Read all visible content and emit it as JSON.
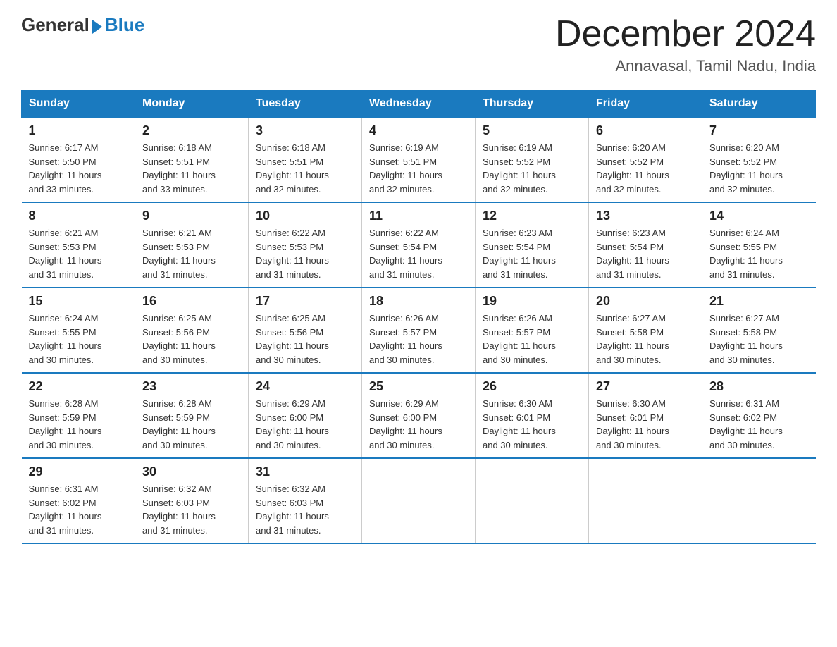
{
  "header": {
    "logo_general": "General",
    "logo_blue": "Blue",
    "title": "December 2024",
    "subtitle": "Annavasal, Tamil Nadu, India"
  },
  "days_of_week": [
    "Sunday",
    "Monday",
    "Tuesday",
    "Wednesday",
    "Thursday",
    "Friday",
    "Saturday"
  ],
  "weeks": [
    [
      {
        "day": "1",
        "sunrise": "6:17 AM",
        "sunset": "5:50 PM",
        "daylight": "11 hours and 33 minutes."
      },
      {
        "day": "2",
        "sunrise": "6:18 AM",
        "sunset": "5:51 PM",
        "daylight": "11 hours and 33 minutes."
      },
      {
        "day": "3",
        "sunrise": "6:18 AM",
        "sunset": "5:51 PM",
        "daylight": "11 hours and 32 minutes."
      },
      {
        "day": "4",
        "sunrise": "6:19 AM",
        "sunset": "5:51 PM",
        "daylight": "11 hours and 32 minutes."
      },
      {
        "day": "5",
        "sunrise": "6:19 AM",
        "sunset": "5:52 PM",
        "daylight": "11 hours and 32 minutes."
      },
      {
        "day": "6",
        "sunrise": "6:20 AM",
        "sunset": "5:52 PM",
        "daylight": "11 hours and 32 minutes."
      },
      {
        "day": "7",
        "sunrise": "6:20 AM",
        "sunset": "5:52 PM",
        "daylight": "11 hours and 32 minutes."
      }
    ],
    [
      {
        "day": "8",
        "sunrise": "6:21 AM",
        "sunset": "5:53 PM",
        "daylight": "11 hours and 31 minutes."
      },
      {
        "day": "9",
        "sunrise": "6:21 AM",
        "sunset": "5:53 PM",
        "daylight": "11 hours and 31 minutes."
      },
      {
        "day": "10",
        "sunrise": "6:22 AM",
        "sunset": "5:53 PM",
        "daylight": "11 hours and 31 minutes."
      },
      {
        "day": "11",
        "sunrise": "6:22 AM",
        "sunset": "5:54 PM",
        "daylight": "11 hours and 31 minutes."
      },
      {
        "day": "12",
        "sunrise": "6:23 AM",
        "sunset": "5:54 PM",
        "daylight": "11 hours and 31 minutes."
      },
      {
        "day": "13",
        "sunrise": "6:23 AM",
        "sunset": "5:54 PM",
        "daylight": "11 hours and 31 minutes."
      },
      {
        "day": "14",
        "sunrise": "6:24 AM",
        "sunset": "5:55 PM",
        "daylight": "11 hours and 31 minutes."
      }
    ],
    [
      {
        "day": "15",
        "sunrise": "6:24 AM",
        "sunset": "5:55 PM",
        "daylight": "11 hours and 30 minutes."
      },
      {
        "day": "16",
        "sunrise": "6:25 AM",
        "sunset": "5:56 PM",
        "daylight": "11 hours and 30 minutes."
      },
      {
        "day": "17",
        "sunrise": "6:25 AM",
        "sunset": "5:56 PM",
        "daylight": "11 hours and 30 minutes."
      },
      {
        "day": "18",
        "sunrise": "6:26 AM",
        "sunset": "5:57 PM",
        "daylight": "11 hours and 30 minutes."
      },
      {
        "day": "19",
        "sunrise": "6:26 AM",
        "sunset": "5:57 PM",
        "daylight": "11 hours and 30 minutes."
      },
      {
        "day": "20",
        "sunrise": "6:27 AM",
        "sunset": "5:58 PM",
        "daylight": "11 hours and 30 minutes."
      },
      {
        "day": "21",
        "sunrise": "6:27 AM",
        "sunset": "5:58 PM",
        "daylight": "11 hours and 30 minutes."
      }
    ],
    [
      {
        "day": "22",
        "sunrise": "6:28 AM",
        "sunset": "5:59 PM",
        "daylight": "11 hours and 30 minutes."
      },
      {
        "day": "23",
        "sunrise": "6:28 AM",
        "sunset": "5:59 PM",
        "daylight": "11 hours and 30 minutes."
      },
      {
        "day": "24",
        "sunrise": "6:29 AM",
        "sunset": "6:00 PM",
        "daylight": "11 hours and 30 minutes."
      },
      {
        "day": "25",
        "sunrise": "6:29 AM",
        "sunset": "6:00 PM",
        "daylight": "11 hours and 30 minutes."
      },
      {
        "day": "26",
        "sunrise": "6:30 AM",
        "sunset": "6:01 PM",
        "daylight": "11 hours and 30 minutes."
      },
      {
        "day": "27",
        "sunrise": "6:30 AM",
        "sunset": "6:01 PM",
        "daylight": "11 hours and 30 minutes."
      },
      {
        "day": "28",
        "sunrise": "6:31 AM",
        "sunset": "6:02 PM",
        "daylight": "11 hours and 30 minutes."
      }
    ],
    [
      {
        "day": "29",
        "sunrise": "6:31 AM",
        "sunset": "6:02 PM",
        "daylight": "11 hours and 31 minutes."
      },
      {
        "day": "30",
        "sunrise": "6:32 AM",
        "sunset": "6:03 PM",
        "daylight": "11 hours and 31 minutes."
      },
      {
        "day": "31",
        "sunrise": "6:32 AM",
        "sunset": "6:03 PM",
        "daylight": "11 hours and 31 minutes."
      },
      null,
      null,
      null,
      null
    ]
  ],
  "labels": {
    "sunrise": "Sunrise:",
    "sunset": "Sunset:",
    "daylight": "Daylight:"
  }
}
